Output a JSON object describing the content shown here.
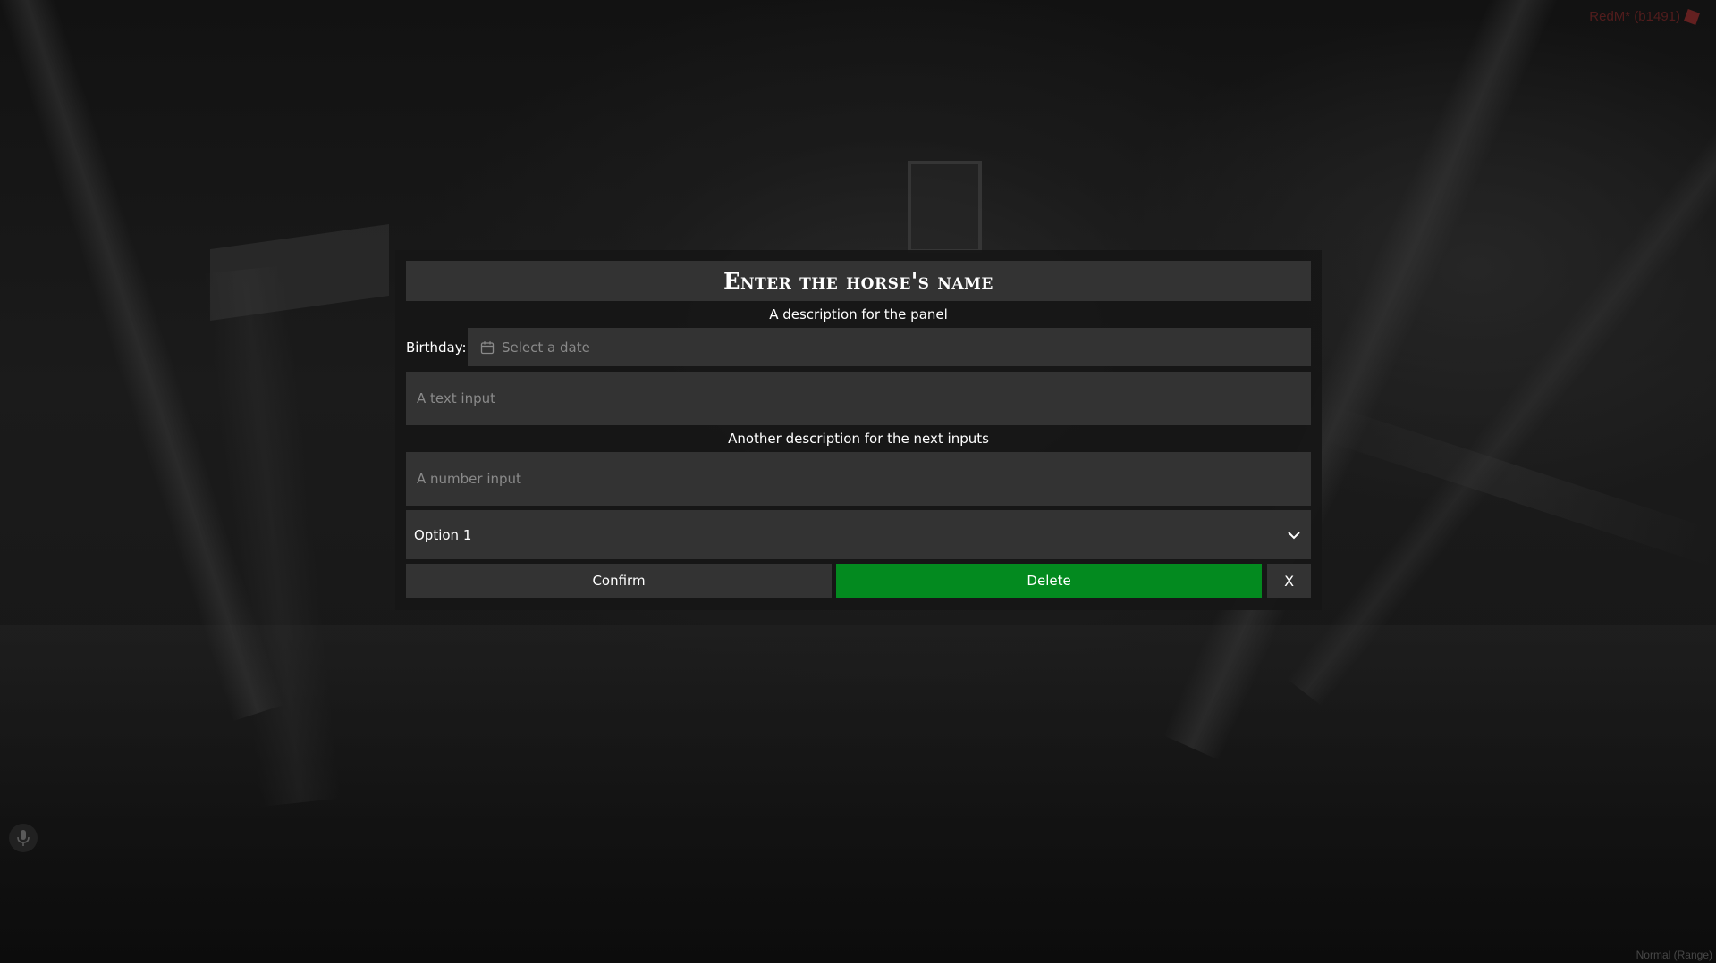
{
  "overlay": {
    "build": "RedM* (b1491)",
    "footer": "Normal (Range)"
  },
  "dialog": {
    "title": "Enter the horse's name",
    "description": "A description for the panel",
    "birthday": {
      "label": "Birthday:",
      "placeholder": "Select a date"
    },
    "text_input": {
      "placeholder": "A text input"
    },
    "description2": "Another description for the next inputs",
    "number_input": {
      "placeholder": "A number input"
    },
    "select": {
      "value": "Option 1"
    },
    "buttons": {
      "confirm": "Confirm",
      "delete": "Delete",
      "close": "X"
    }
  },
  "colors": {
    "delete_button": "#038a1f",
    "field_background": "#333333",
    "panel_background": "#161616"
  },
  "icons": {
    "date": "calendar-icon",
    "select": "chevron-down-icon",
    "voice": "microphone-icon",
    "build": "redm-logo-icon"
  }
}
